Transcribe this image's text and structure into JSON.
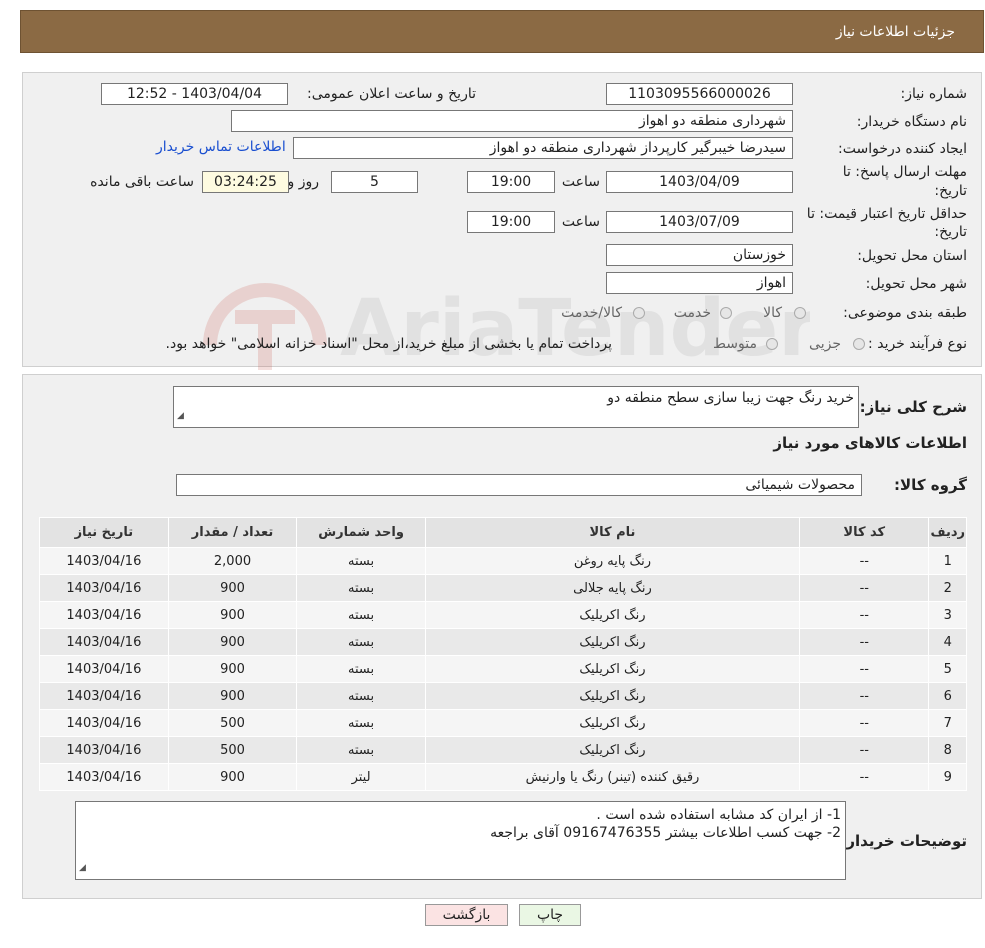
{
  "header": {
    "title": "جزئیات اطلاعات نیاز"
  },
  "watermark": {
    "text": "AriaTender.neT"
  },
  "form": {
    "need_number_label": "شماره نیاز:",
    "need_number": "1103095566000026",
    "announce_label": "تاریخ و ساعت اعلان عمومی:",
    "announce_value": "1403/04/04 - 12:52",
    "buyer_org_label": "نام دستگاه خریدار:",
    "buyer_org": "شهرداری منطقه دو اهواز",
    "creator_label": "ایجاد کننده درخواست:",
    "creator": "سیدرضا خیبرگیر کارپرداز  شهرداری منطقه دو اهواز",
    "contact_link": "اطلاعات تماس خریدار",
    "deadline_label_1": "مهلت ارسال پاسخ: تا",
    "deadline_label_2": "تاریخ:",
    "deadline_date": "1403/04/09",
    "time_word": "ساعت",
    "deadline_time": "19:00",
    "days_value": "5",
    "days_word": "روز و",
    "remaining_time": "03:24:25",
    "remaining_word": "ساعت باقی مانده",
    "validity_label_1": "حداقل تاریخ اعتبار قیمت: تا",
    "validity_label_2": "تاریخ:",
    "validity_date": "1403/07/09",
    "validity_time": "19:00",
    "province_label": "استان محل تحویل:",
    "province": "خوزستان",
    "city_label": "شهر محل تحویل:",
    "city": "اهواز",
    "category_label": "طبقه بندی موضوعی:",
    "category_options": [
      "کالا",
      "خدمت",
      "کالا/خدمت"
    ],
    "process_label": "نوع فرآیند خرید :",
    "process_options": [
      "جزیی",
      "متوسط"
    ],
    "process_note": "پرداخت تمام یا بخشی از مبلغ خرید،از محل \"اسناد خزانه اسلامی\" خواهد بود."
  },
  "summary": {
    "desc_label": "شرح کلی نیاز:",
    "desc_value": "خرید رنگ جهت زیبا سازی سطح منطقه دو",
    "items_title": "اطلاعات کالاهای مورد نیاز",
    "group_label": "گروه کالا:",
    "group_value": "محصولات شیمیائی"
  },
  "table": {
    "headers": [
      "ردیف",
      "کد کالا",
      "نام کالا",
      "واحد شمارش",
      "تعداد / مقدار",
      "تاریخ نیاز"
    ],
    "rows": [
      [
        "1",
        "--",
        "رنگ پایه روغن",
        "بسته",
        "2,000",
        "1403/04/16"
      ],
      [
        "2",
        "--",
        "رنگ پایه جلالی",
        "بسته",
        "900",
        "1403/04/16"
      ],
      [
        "3",
        "--",
        "رنگ اکریلیک",
        "بسته",
        "900",
        "1403/04/16"
      ],
      [
        "4",
        "--",
        "رنگ اکریلیک",
        "بسته",
        "900",
        "1403/04/16"
      ],
      [
        "5",
        "--",
        "رنگ اکریلیک",
        "بسته",
        "900",
        "1403/04/16"
      ],
      [
        "6",
        "--",
        "رنگ اکریلیک",
        "بسته",
        "900",
        "1403/04/16"
      ],
      [
        "7",
        "--",
        "رنگ اکریلیک",
        "بسته",
        "500",
        "1403/04/16"
      ],
      [
        "8",
        "--",
        "رنگ اکریلیک",
        "بسته",
        "500",
        "1403/04/16"
      ],
      [
        "9",
        "--",
        "رقیق کننده (تینر) رنگ یا وارنیش",
        "لیتر",
        "900",
        "1403/04/16"
      ]
    ]
  },
  "notes": {
    "label": "توضیحات خریدار:",
    "line1": "1- از ایران کد مشابه استفاده شده است .",
    "line2": "2- جهت کسب اطلاعات بیشتر 09167476355 آقای براجعه"
  },
  "buttons": {
    "print": "چاپ",
    "back": "بازگشت"
  }
}
